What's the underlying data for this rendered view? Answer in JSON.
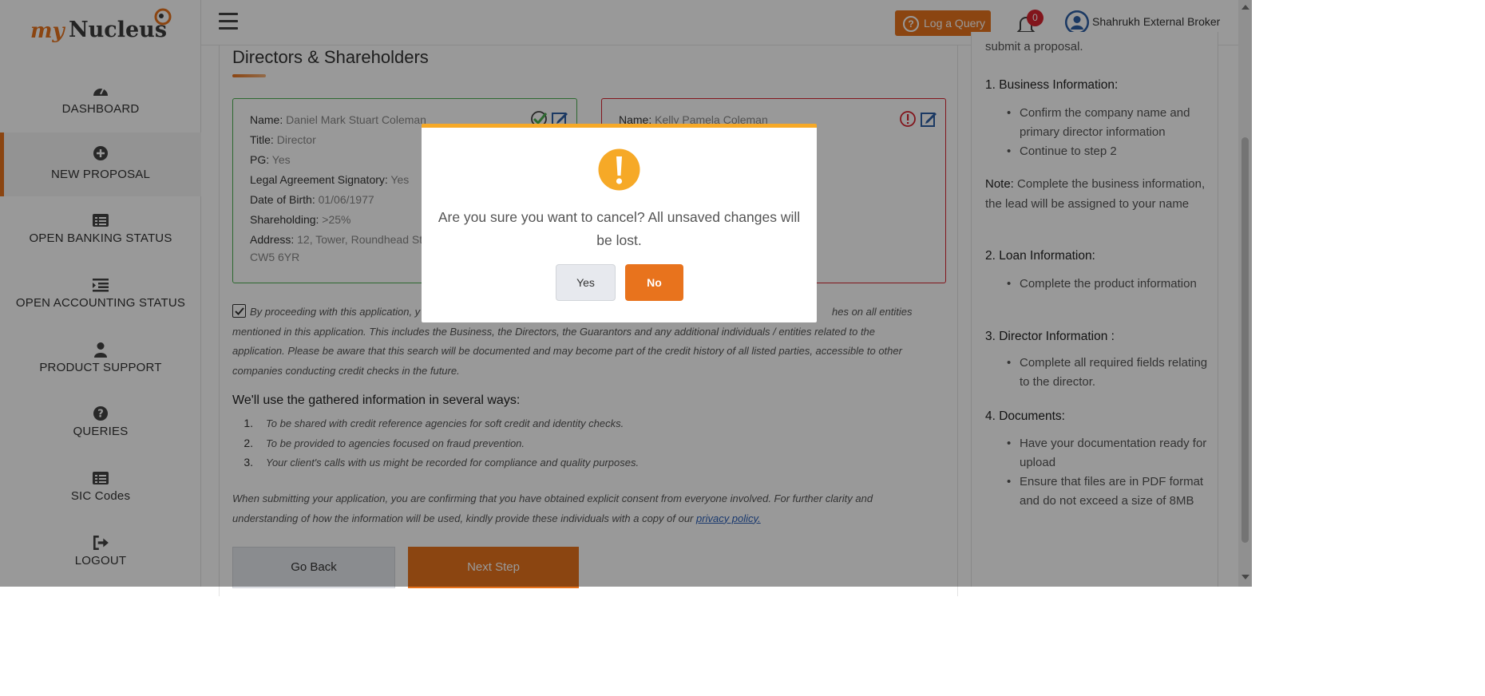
{
  "brand": {
    "my": "my",
    "nucleus": "Nucleus",
    "accent": "#e8731d"
  },
  "sidebar": {
    "items": [
      {
        "label": "DASHBOARD",
        "icon": "dashboard-gauge-icon"
      },
      {
        "label": "NEW PROPOSAL",
        "icon": "plus-circle-icon",
        "active": true
      },
      {
        "label": "OPEN BANKING STATUS",
        "icon": "list-alt-icon"
      },
      {
        "label": "OPEN ACCOUNTING STATUS",
        "icon": "indent-list-icon"
      },
      {
        "label": "PRODUCT SUPPORT",
        "icon": "user-icon"
      },
      {
        "label": "QUERIES",
        "icon": "question-circle-icon"
      },
      {
        "label": "SIC Codes",
        "icon": "list-alt-icon"
      },
      {
        "label": "LOGOUT",
        "icon": "sign-out-icon"
      }
    ]
  },
  "header": {
    "log_query": "Log a Query",
    "notifications": "0",
    "user_name": "Shahrukh External Broker"
  },
  "main": {
    "section_title": "Directors & Shareholders",
    "directors": [
      {
        "status": "complete",
        "name_label": "Name:",
        "name": "Daniel Mark Stuart Coleman",
        "title_label": "Title:",
        "title": "Director",
        "pg_label": "PG:",
        "pg": "Yes",
        "signatory_label": "Legal Agreement Signatory:",
        "signatory": "Yes",
        "dob_label": "Date of Birth:",
        "dob": "01/06/1977",
        "share_label": "Shareholding:",
        "share": ">25%",
        "address_label": "Address:",
        "address_line1": "12, Tower, Roundhead St",
        "address_line2": "CW5 6YR"
      },
      {
        "status": "incomplete",
        "name_label": "Name:",
        "name": "Kelly Pamela Coleman"
      }
    ],
    "consent_visible_part1": "By proceeding with this application, y",
    "consent_visible_part2": "hes on all entities",
    "consent_line2": "mentioned in this application. This includes the Business, the Directors, the Guarantors and any additional individuals / entities related to the",
    "consent_line3": "application. Please be aware that this search will be documented and may become part of the credit history of all listed parties, accessible to other",
    "consent_line4": "companies conducting credit checks in the future.",
    "ways_title": "We'll use the gathered information in several ways:",
    "ways": [
      "To be shared with credit reference agencies for soft credit and identity checks.",
      "To be provided to agencies focused on fraud prevention.",
      "Your client's calls with us might be recorded for compliance and quality purposes."
    ],
    "submit_text": "When submitting your application, you are confirming that you have obtained explicit consent from everyone involved. For further clarity and understanding of how the information will be used, kindly provide these individuals with a copy of our ",
    "privacy_link": "privacy policy.",
    "go_back": "Go Back",
    "next_step": "Next Step"
  },
  "guide": {
    "top_text": "submit a proposal.",
    "s1_title": "1. Business Information:",
    "s1_items": [
      "Confirm the company name and primary director information",
      "Continue to step 2"
    ],
    "note_label": "Note:",
    "note_text": " Complete the business information, the lead will be assigned to your name",
    "s2_title": "2. Loan Information:",
    "s2_items": [
      "Complete the product information"
    ],
    "s3_title": "3. Director Information :",
    "s3_items": [
      "Complete all required fields relating to the director."
    ],
    "s4_title": "4. Documents:",
    "s4_items": [
      "Have your documentation ready for upload",
      "Ensure that files are in PDF format and do not exceed a size of 8MB"
    ]
  },
  "modal": {
    "icon": "exclamation-warning-icon",
    "message": "Are you sure you want to cancel? All unsaved changes will be lost.",
    "yes": "Yes",
    "no": "No",
    "warning_color": "#f6a927"
  }
}
